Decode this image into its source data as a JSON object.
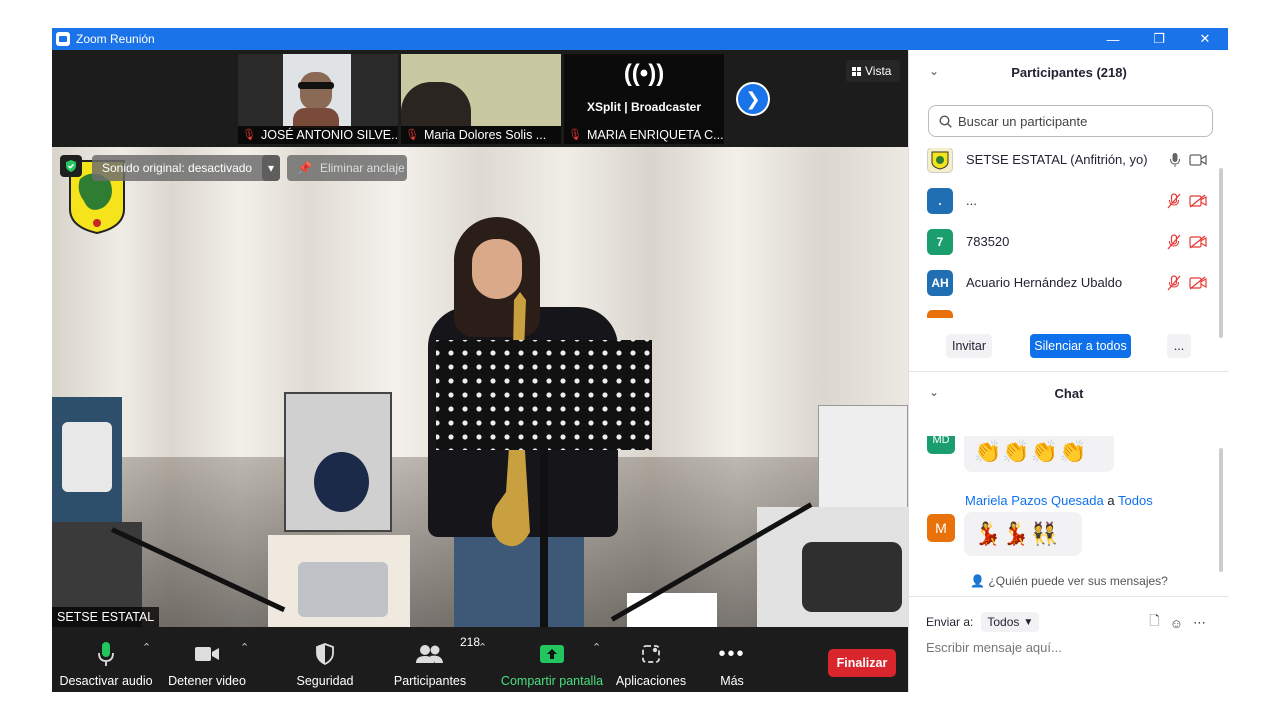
{
  "window": {
    "title": "Zoom Reunión"
  },
  "thumbnails": [
    {
      "name": "JOSÉ ANTONIO SILVE..."
    },
    {
      "name": "Maria Dolores Solis ..."
    },
    {
      "name": "MARIA ENRIQUETA C..."
    }
  ],
  "broadcaster": {
    "brand": "XSplit | Broadcaster"
  },
  "view_button": "Vista",
  "overlays": {
    "original_sound": "Sonido original: desactivado",
    "unpin": "Eliminar anclaje",
    "speaker_name": "SETSE ESTATAL"
  },
  "toolbar": {
    "mute": "Desactivar audio",
    "video": "Detener video",
    "security": "Seguridad",
    "participants": "Participantes",
    "participants_count": "218",
    "share": "Compartir pantalla",
    "apps": "Aplicaciones",
    "more": "Más",
    "end": "Finalizar"
  },
  "participants_panel": {
    "title": "Participantes (218)",
    "search_placeholder": "Buscar un participante",
    "rows": [
      {
        "initials": "",
        "name": "SETSE ESTATAL (Anfitrión, yo)",
        "color": "#f6f0c8"
      },
      {
        "initials": ".",
        "name": "...",
        "color": "#1f6fb2"
      },
      {
        "initials": "7",
        "name": "783520",
        "color": "#1a9e6e"
      },
      {
        "initials": "AH",
        "name": "Acuario Hernández Ubaldo",
        "color": "#1f6fb2"
      }
    ],
    "invite": "Invitar",
    "mute_all": "Silenciar a todos",
    "more": "..."
  },
  "chat_panel": {
    "title": "Chat",
    "messages": [
      {
        "avatar": "MD",
        "sender": "",
        "content": "👏👏👏👏"
      },
      {
        "avatar": "M",
        "sender": "Mariela Pazos Quesada",
        "to_word": "a",
        "recipient": "Todos",
        "content": "💃💃👯"
      }
    ],
    "who_can_see": "¿Quién puede ver sus mensajes?",
    "send_to_label": "Enviar a:",
    "send_to_value": "Todos",
    "input_placeholder": "Escribir mensaje aquí..."
  },
  "colors": {
    "accent": "#0e71eb",
    "titlebar": "#1a73e8",
    "end": "#d9252c",
    "share": "#22c55e",
    "muted": "#e53935"
  }
}
